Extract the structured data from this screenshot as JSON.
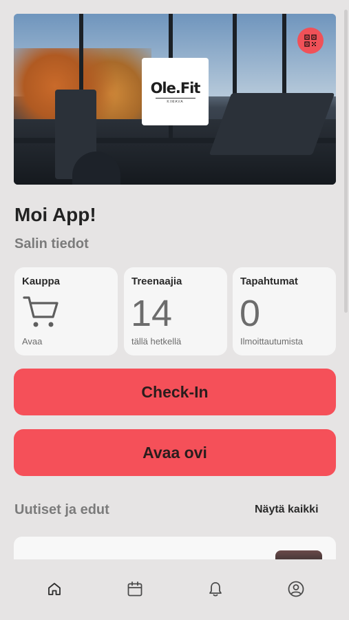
{
  "hero": {
    "logo_text": "Ole.Fit",
    "logo_sub": "KIMAVA",
    "qr_icon": "qr-code-icon"
  },
  "greeting": "Moi App!",
  "gym_info_heading": "Salin tiedot",
  "stats": [
    {
      "title": "Kauppa",
      "value": "",
      "icon": "cart-icon",
      "caption": "Avaa"
    },
    {
      "title": "Treenaajia",
      "value": "14",
      "caption": "tällä hetkellä"
    },
    {
      "title": "Tapahtumat",
      "value": "0",
      "caption": "Ilmoittautumista"
    }
  ],
  "buttons": {
    "check_in": "Check-In",
    "open_door": "Avaa ovi"
  },
  "news": {
    "title": "Uutiset ja edut",
    "see_all": "Näytä kaikki"
  },
  "tabbar": {
    "items": [
      "home-icon",
      "calendar-icon",
      "bell-icon",
      "profile-icon"
    ]
  },
  "colors": {
    "accent": "#f55059",
    "background": "#e6e4e4",
    "card": "#f6f6f6"
  }
}
